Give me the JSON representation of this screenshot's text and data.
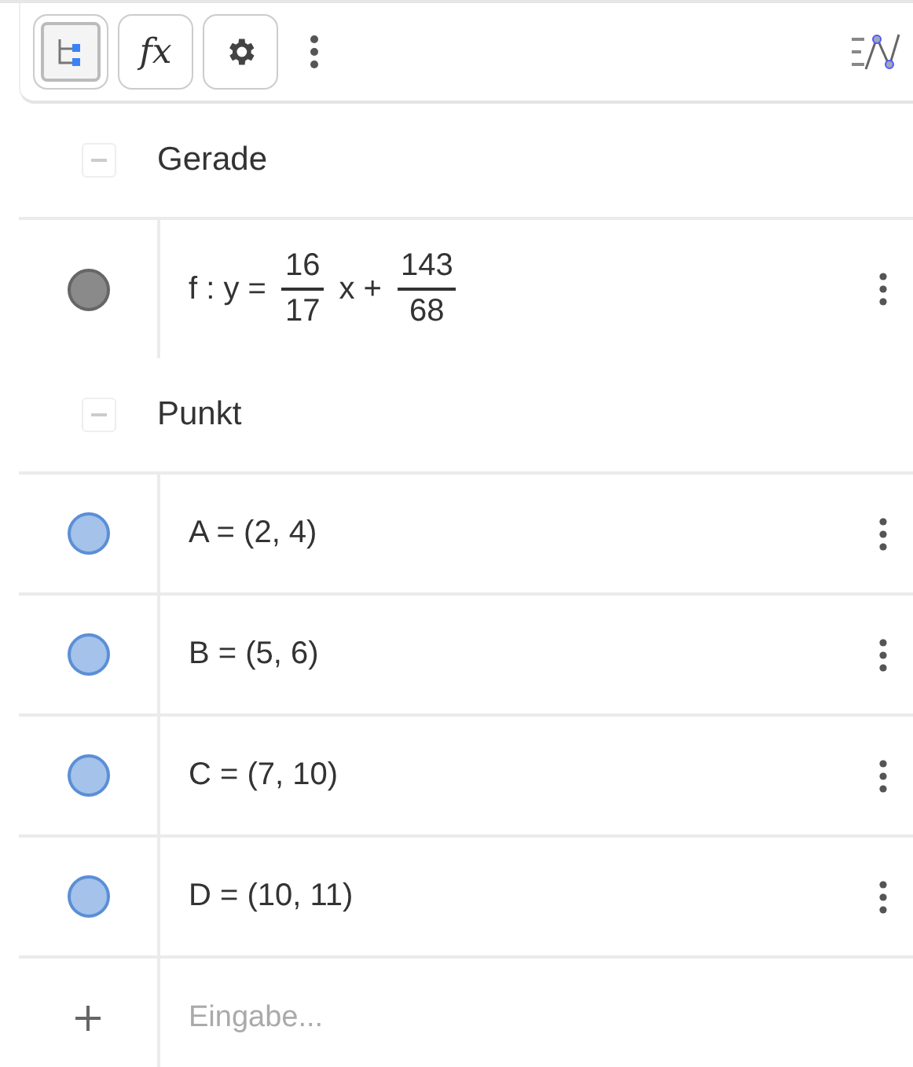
{
  "toolbar": {
    "buttons": [
      {
        "kind": "tree",
        "selected": true
      },
      {
        "kind": "fx",
        "label": "fx",
        "selected": false
      },
      {
        "kind": "gear",
        "selected": false
      }
    ]
  },
  "groups": [
    {
      "title": "Gerade",
      "expanded": true,
      "items": [
        {
          "color": "#8a8a8a",
          "expression": [
            {
              "kind": "text",
              "text": "f : y ="
            },
            {
              "kind": "fraction",
              "num": "16",
              "den": "17"
            },
            {
              "kind": "text",
              "text": "x +"
            },
            {
              "kind": "fraction",
              "num": "143",
              "den": "68"
            }
          ]
        }
      ]
    },
    {
      "title": "Punkt",
      "expanded": true,
      "items": [
        {
          "color": "#a4c2ea",
          "expression": [
            {
              "kind": "text",
              "text": "A = (2, 4)"
            }
          ]
        },
        {
          "color": "#a4c2ea",
          "expression": [
            {
              "kind": "text",
              "text": "B = (5, 6)"
            }
          ]
        },
        {
          "color": "#a4c2ea",
          "expression": [
            {
              "kind": "text",
              "text": "C = (7, 10)"
            }
          ]
        },
        {
          "color": "#a4c2ea",
          "expression": [
            {
              "kind": "text",
              "text": "D = (10, 11)"
            }
          ]
        }
      ]
    }
  ],
  "input": {
    "placeholder": "Eingabe..."
  }
}
